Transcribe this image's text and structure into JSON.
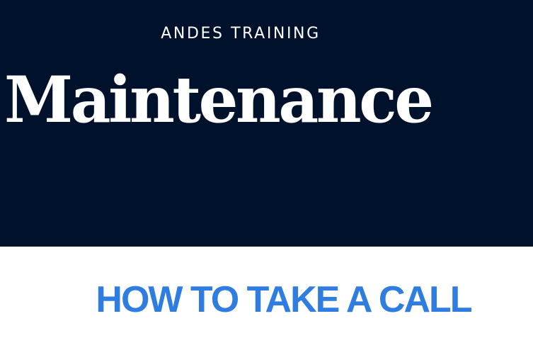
{
  "header": {
    "eyebrow": "ANDES TRAINING",
    "title": "Maintenance"
  },
  "section": {
    "heading": "HOW TO TAKE A CALL"
  },
  "colors": {
    "hero_background": "#00122b",
    "hero_text": "#ffffff",
    "heading_accent": "#2f7de1",
    "page_background": "#ffffff"
  }
}
